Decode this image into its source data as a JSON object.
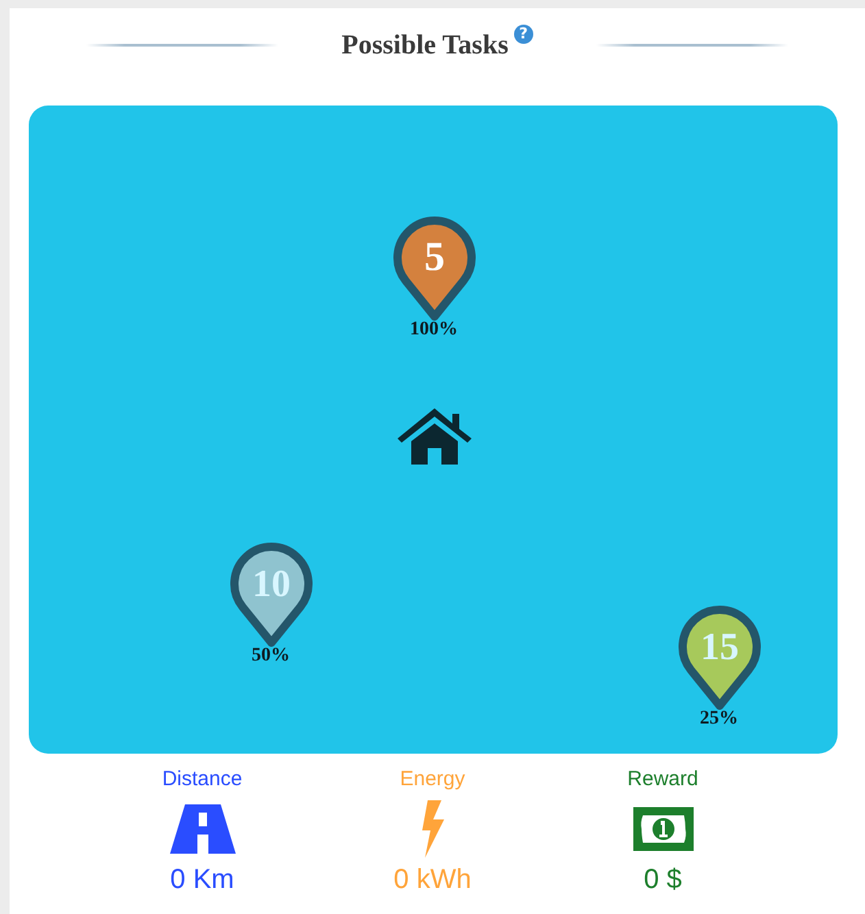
{
  "title": "Possible Tasks",
  "help_icon": "?",
  "map": {
    "pins": [
      {
        "label": "5",
        "percent": "100%",
        "color": "#d4813e"
      },
      {
        "label": "10",
        "percent": "50%",
        "color": "#8fc3cf"
      },
      {
        "label": "15",
        "percent": "25%",
        "color": "#a7c95b"
      }
    ]
  },
  "stats": [
    {
      "kind": "distance",
      "label": "Distance",
      "value": "0 Km",
      "color": "#2a4dff"
    },
    {
      "kind": "energy",
      "label": "Energy",
      "value": "0 kWh",
      "color": "#ffa43a"
    },
    {
      "kind": "reward",
      "label": "Reward",
      "value": "0 $",
      "color": "#1d7f2c"
    }
  ]
}
